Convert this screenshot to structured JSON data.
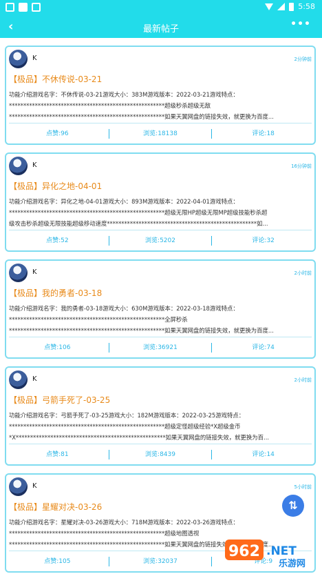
{
  "status_bar": {
    "time": "5:58",
    "sim_label": "A"
  },
  "app_bar": {
    "back_icon": "back-arrow-icon",
    "title": "最新帖子",
    "more_label": "•••"
  },
  "posts": [
    {
      "author": "K",
      "time": "2分钟前",
      "title": "【极品】不休传说-03-21",
      "lines": [
        "功能介绍游戏名字：不休传说-03-21游戏大小：383M游戏版本：2022-03-21游戏特点：",
        "******************************************************超级秒杀超级无敌",
        "******************************************************如果天翼网盘的链接失效，就更换为百度..."
      ],
      "likes": "点赞:96",
      "views": "浏览:18138",
      "comments": "评论:18"
    },
    {
      "author": "K",
      "time": "16分钟前",
      "title": "【极品】异化之地-04-01",
      "lines": [
        "功能介绍游戏名字：异化之地-04-01游戏大小：893M游戏版本：2022-04-01游戏特点：",
        "******************************************************超级无限HP超级无限MP超级技能秒杀超",
        "级攻击秒杀超级无限技能超级移动速度****************************************************如..."
      ],
      "likes": "点赞:52",
      "views": "浏览:5202",
      "comments": "评论:32"
    },
    {
      "author": "K",
      "time": "2小时前",
      "title": "【极品】我的勇者-03-18",
      "lines": [
        "功能介绍游戏名字：我的勇者-03-18游戏大小：630M游戏版本：2022-03-18游戏特点：",
        "******************************************************全屏秒杀",
        "******************************************************如果天翼网盘的链接失效，就更换为百度..."
      ],
      "likes": "点赞:106",
      "views": "浏览:36921",
      "comments": "评论:74"
    },
    {
      "author": "K",
      "time": "2小时前",
      "title": "【极品】弓箭手死了-03-25",
      "lines": [
        "功能介绍游戏名字：弓箭手死了-03-25游戏大小：182M游戏版本：2022-03-25游戏特点：",
        "******************************************************超级定怪超级经验*X超级金币",
        "*X****************************************************如果天翼网盘的链接失效，就更换为百..."
      ],
      "likes": "点赞:81",
      "views": "浏览:8439",
      "comments": "评论:14"
    },
    {
      "author": "K",
      "time": "5小时前",
      "title": "【极品】星耀对决-03-26",
      "lines": [
        "功能介绍游戏名字：星耀对决-03-26游戏大小：718M游戏版本：2022-03-26游戏特点：",
        "******************************************************超级地图透视",
        "******************************************************如果天翼网盘的链接失效，就更换为百度..."
      ],
      "likes": "点赞:105",
      "views": "浏览:32037",
      "comments": "评论:9"
    }
  ],
  "fab_icon": "sort-arrows-icon",
  "watermark": {
    "main": "962",
    "sub": ".NET",
    "cn": "乐游网"
  }
}
